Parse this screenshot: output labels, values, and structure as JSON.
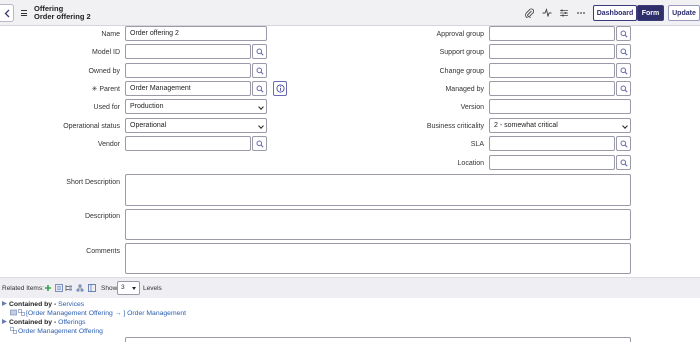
{
  "header": {
    "record_type": "Offering",
    "record_name": "Order offering 2",
    "buttons": {
      "dashboard": "Dashboard",
      "form": "Form",
      "update": "Update"
    },
    "icons": [
      "back-icon",
      "hamburger-icon",
      "paperclip-icon",
      "activity-icon",
      "settings-sliders-icon",
      "more-icon"
    ]
  },
  "form": {
    "left": {
      "name": {
        "label": "Name",
        "value": "Order offering 2"
      },
      "model_id": {
        "label": "Model ID",
        "value": ""
      },
      "owned_by": {
        "label": "Owned by",
        "value": ""
      },
      "parent": {
        "required": "✳",
        "label": "Parent",
        "value": "Order Management"
      },
      "used_for": {
        "label": "Used for",
        "value": "Production"
      },
      "operational_status": {
        "label": "Operational status",
        "value": "Operational"
      },
      "vendor": {
        "label": "Vendor",
        "value": ""
      }
    },
    "right": {
      "approval_group": {
        "label": "Approval group",
        "value": ""
      },
      "support_group": {
        "label": "Support group",
        "value": ""
      },
      "change_group": {
        "label": "Change group",
        "value": ""
      },
      "managed_by": {
        "label": "Managed by",
        "value": ""
      },
      "version": {
        "label": "Version",
        "value": ""
      },
      "business_criticality": {
        "label": "Business criticality",
        "value": "2 - somewhat critical"
      },
      "sla": {
        "label": "SLA",
        "value": ""
      },
      "location": {
        "label": "Location",
        "value": ""
      }
    },
    "short_description": {
      "label": "Short Description",
      "value": ""
    },
    "description": {
      "label": "Description",
      "value": ""
    },
    "comments": {
      "label": "Comments",
      "value": ""
    }
  },
  "related": {
    "label": "Related Items:",
    "show_label": "Show",
    "levels_value": "3",
    "levels_label": "Levels",
    "tree": [
      {
        "relation": "Contained by",
        "separator": " - ",
        "type": "Services",
        "item": "[Order Management Offering → ] Order Management"
      },
      {
        "relation": "Contained by",
        "separator": " - ",
        "type": "Offerings",
        "item": "Order Management Offering"
      }
    ]
  },
  "colors": {
    "brand": "#2f2f6b",
    "link": "#2a5db0",
    "header_bg": "#f1f1f4"
  }
}
